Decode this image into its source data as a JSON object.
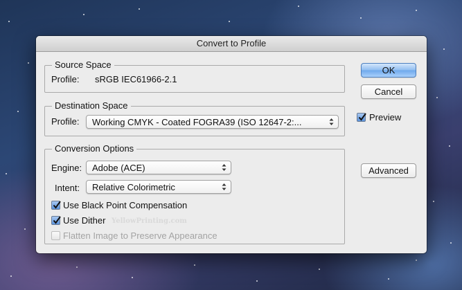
{
  "window": {
    "title": "Convert to Profile"
  },
  "source_space": {
    "legend": "Source Space",
    "profile_label": "Profile:",
    "profile_value": "sRGB IEC61966-2.1"
  },
  "destination_space": {
    "legend": "Destination Space",
    "profile_label": "Profile:",
    "profile_value": "Working CMYK - Coated FOGRA39 (ISO 12647-2:..."
  },
  "conversion_options": {
    "legend": "Conversion Options",
    "engine_label": "Engine:",
    "engine_value": "Adobe (ACE)",
    "intent_label": "Intent:",
    "intent_value": "Relative Colorimetric",
    "black_point": {
      "label": "Use Black Point Compensation",
      "checked": true
    },
    "dither": {
      "label": "Use Dither",
      "checked": true
    },
    "flatten": {
      "label": "Flatten Image to Preserve Appearance",
      "checked": false,
      "enabled": false
    }
  },
  "buttons": {
    "ok": "OK",
    "cancel": "Cancel",
    "advanced": "Advanced"
  },
  "preview": {
    "label": "Preview",
    "checked": true
  },
  "watermark": "YellowPrinting.com",
  "colors": {
    "accent": "#6ea8ec",
    "dialog_bg": "#ececec"
  }
}
